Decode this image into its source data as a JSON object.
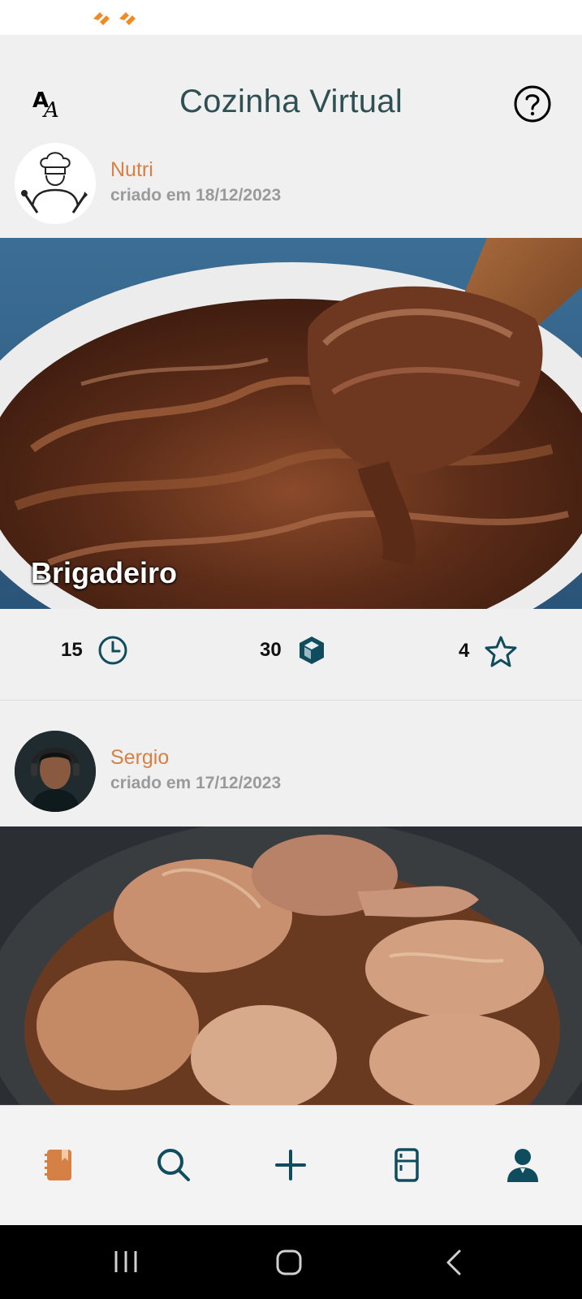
{
  "app": {
    "title": "Cozinha Virtual"
  },
  "header": {
    "font_size_icon": "font-size-icon",
    "help_icon": "help-circle-icon"
  },
  "feed": [
    {
      "author": "Nutri",
      "date": "criado em 18/12/2023",
      "recipe_name": "Brigadeiro",
      "time": "15",
      "servings": "30",
      "rating": "4",
      "image_subject": "chocolate brigadeiro on wooden spoon"
    },
    {
      "author": "Sergio",
      "date": "criado em 17/12/2023",
      "image_subject": "braised chicken drumsticks in pot"
    }
  ],
  "bottom_nav": {
    "items": [
      {
        "icon": "recipe-book-icon",
        "active": true
      },
      {
        "icon": "search-icon",
        "active": false
      },
      {
        "icon": "plus-icon",
        "active": false
      },
      {
        "icon": "fridge-icon",
        "active": false
      },
      {
        "icon": "profile-icon",
        "active": false
      }
    ]
  },
  "colors": {
    "accent_orange": "#d58044",
    "teal_dark": "#0f4d5e",
    "title_color": "#2f5052",
    "date_gray": "#9a9a9a",
    "background": "#f0f0f0"
  }
}
